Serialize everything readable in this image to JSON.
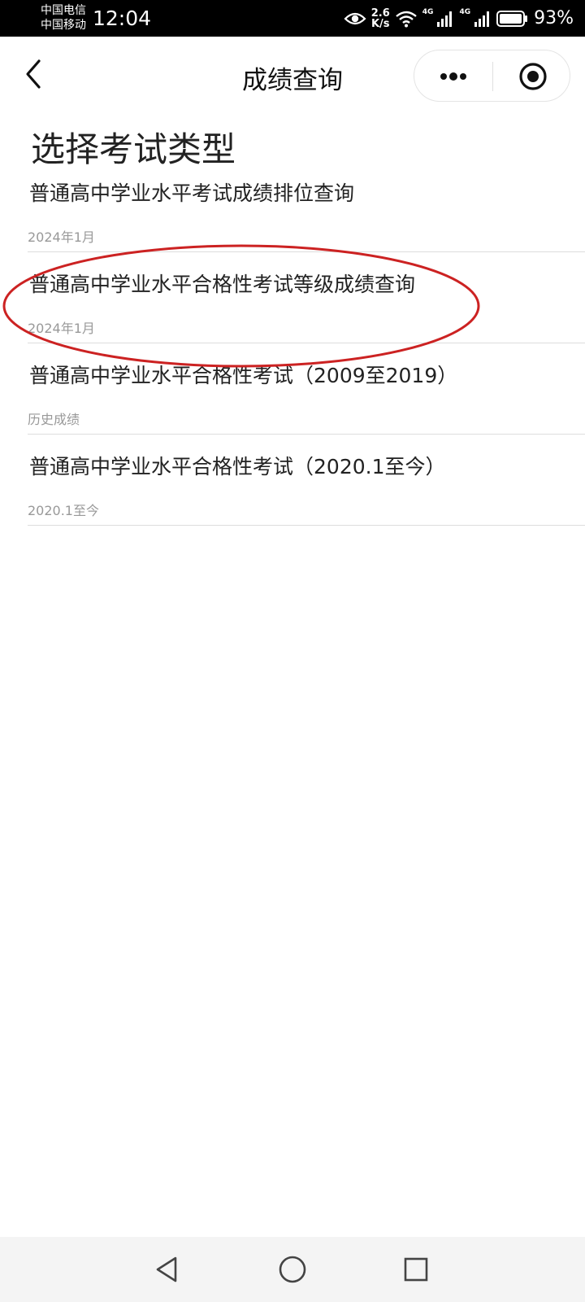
{
  "status_bar": {
    "carrier_1": "中国电信",
    "carrier_2": "中国移动",
    "time": "12:04",
    "speed_value": "2.6",
    "speed_unit": "K/s",
    "net_label_1": "4G",
    "net_label_2": "4G",
    "battery": "93%"
  },
  "nav": {
    "title": "成绩查询"
  },
  "content": {
    "heading": "选择考试类型",
    "items": [
      {
        "title": "普通高中学业水平考试成绩排位查询",
        "subtitle": "2024年1月"
      },
      {
        "title": "普通高中学业水平合格性考试等级成绩查询",
        "subtitle": "2024年1月"
      },
      {
        "title": "普通高中学业水平合格性考试（2009至2019）",
        "subtitle": "历史成绩"
      },
      {
        "title": "普通高中学业水平合格性考试（2020.1至今）",
        "subtitle": "2020.1至今"
      }
    ]
  },
  "annotation_color": "#cc2222",
  "icons": {
    "eye": "eye-icon",
    "wifi": "wifi-icon",
    "signal": "signal-icon",
    "battery": "battery-icon",
    "back": "chevron-left-icon",
    "more": "more-dots-icon",
    "target": "target-icon",
    "sys_back": "triangle-back-icon",
    "sys_home": "circle-home-icon",
    "sys_recent": "square-recent-icon"
  }
}
